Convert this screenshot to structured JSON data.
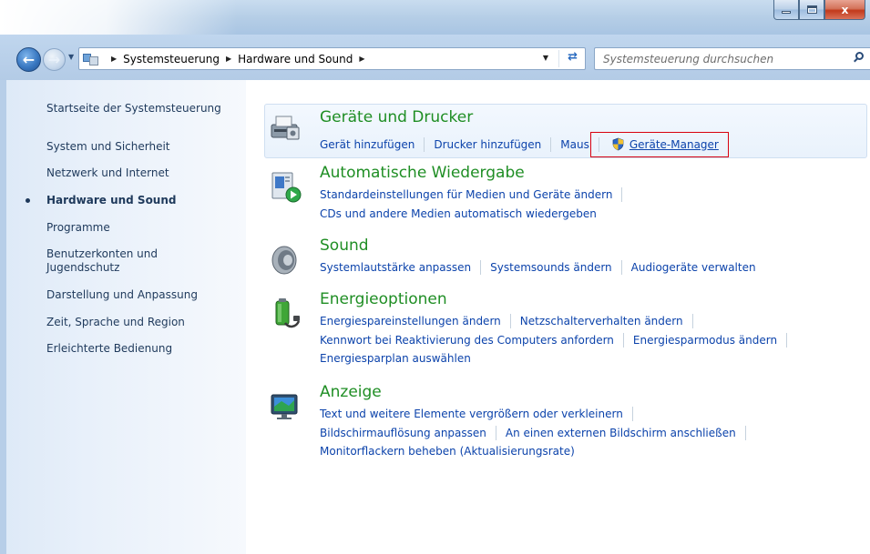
{
  "window": {
    "caption": {
      "minimize": "minimize-icon",
      "maximize": "maximize-icon",
      "close_label": "x"
    }
  },
  "navbar": {
    "breadcrumb": [
      "Systemsteuerung",
      "Hardware und Sound"
    ],
    "search_placeholder": "Systemsteuerung durchsuchen"
  },
  "sidebar": {
    "items": [
      {
        "label": "Startseite der Systemsteuerung",
        "active": false
      },
      {
        "label": "System und Sicherheit",
        "active": false
      },
      {
        "label": "Netzwerk und Internet",
        "active": false
      },
      {
        "label": "Hardware und Sound",
        "active": true
      },
      {
        "label": "Programme",
        "active": false
      },
      {
        "label": "Benutzerkonten und Jugendschutz",
        "active": false
      },
      {
        "label": "Darstellung und Anpassung",
        "active": false
      },
      {
        "label": "Zeit, Sprache und Region",
        "active": false
      },
      {
        "label": "Erleichterte Bedienung",
        "active": false
      }
    ]
  },
  "categories": [
    {
      "title": "Geräte und Drucker",
      "icon": "printer-icon",
      "lines": [
        [
          "Gerät hinzufügen",
          "Drucker hinzufügen",
          "Maus",
          "Geräte-Manager"
        ]
      ],
      "highlighted_link": "Geräte-Manager"
    },
    {
      "title": "Automatische Wiedergabe",
      "icon": "autoplay-icon",
      "lines": [
        [
          "Standardeinstellungen für Medien und Geräte ändern"
        ],
        [
          "CDs und andere Medien automatisch wiedergeben"
        ]
      ]
    },
    {
      "title": "Sound",
      "icon": "speaker-icon",
      "lines": [
        [
          "Systemlautstärke anpassen",
          "Systemsounds ändern",
          "Audiogeräte verwalten"
        ]
      ]
    },
    {
      "title": "Energieoptionen",
      "icon": "battery-icon",
      "lines": [
        [
          "Energiespareinstellungen ändern",
          "Netzschalterverhalten ändern"
        ],
        [
          "Kennwort bei Reaktivierung des Computers anfordern",
          "Energiesparmodus ändern"
        ],
        [
          "Energiesparplan auswählen"
        ]
      ]
    },
    {
      "title": "Anzeige",
      "icon": "monitor-icon",
      "lines": [
        [
          "Text und weitere Elemente vergrößern oder verkleinern"
        ],
        [
          "Bildschirmauflösung anpassen",
          "An einen externen Bildschirm anschließen"
        ],
        [
          "Monitorflackern beheben (Aktualisierungsrate)"
        ]
      ]
    }
  ],
  "colors": {
    "category_title": "#1f8e24",
    "link": "#0c43ab",
    "nav_text": "#1e395b",
    "highlight_border": "#d8000f"
  }
}
